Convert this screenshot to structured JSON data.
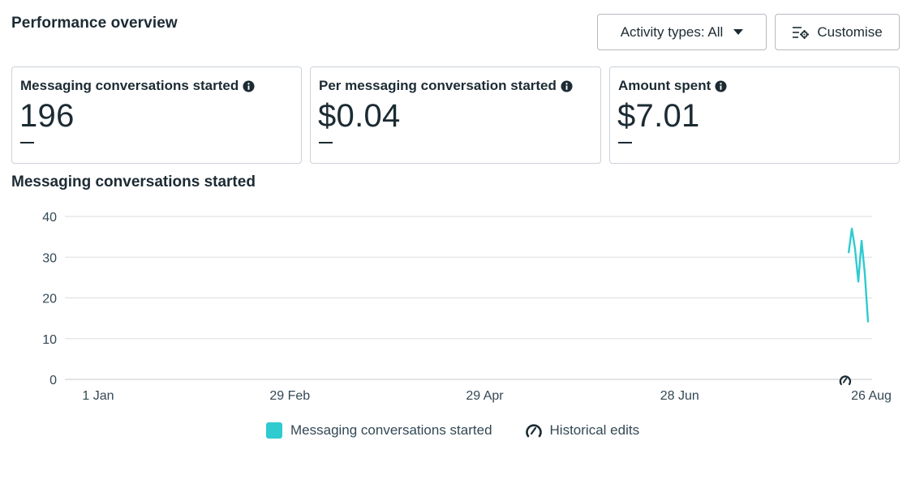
{
  "header": {
    "title": "Performance overview",
    "activity_button_label": "Activity types: All",
    "customise_button_label": "Customise"
  },
  "cards": [
    {
      "label": "Messaging conversations started",
      "value": "196",
      "delta": "—"
    },
    {
      "label": "Per messaging conversation started",
      "value": "$0.04",
      "delta": "—"
    },
    {
      "label": "Amount spent",
      "value": "$7.01",
      "delta": "—"
    }
  ],
  "chart": {
    "title": "Messaging conversations started"
  },
  "legend": {
    "series_label": "Messaging conversations started",
    "edits_label": "Historical edits"
  },
  "icons": {
    "info": "info-icon",
    "caret": "caret-down-icon",
    "customise": "customise-icon",
    "historical_edits": "historical-edits-icon"
  },
  "colors": {
    "series": "#2ecbd0",
    "text": "#1c2b33",
    "grid": "#dadde1"
  },
  "chart_data": {
    "type": "line",
    "title": "Messaging conversations started",
    "xlabel": "",
    "ylabel": "",
    "ylim": [
      0,
      40
    ],
    "yticks": [
      0,
      10,
      20,
      30,
      40
    ],
    "x_tick_labels": [
      "1 Jan",
      "29 Feb",
      "29 Apr",
      "28 Jun",
      "26 Aug"
    ],
    "x_tick_dates": [
      "2024-01-01",
      "2024-02-29",
      "2024-04-29",
      "2024-06-28",
      "2024-08-26"
    ],
    "xlim": [
      "2024-01-01",
      "2024-08-26"
    ],
    "grid": true,
    "legend_position": "bottom",
    "series": [
      {
        "name": "Messaging conversations started",
        "color": "#2ecbd0",
        "x": [
          "2024-08-19",
          "2024-08-20",
          "2024-08-21",
          "2024-08-22",
          "2024-08-23",
          "2024-08-24",
          "2024-08-25"
        ],
        "y": [
          31,
          37,
          32,
          24,
          34,
          26,
          14
        ]
      }
    ],
    "markers": [
      {
        "label": "Historical edits",
        "x": "2024-08-18"
      }
    ]
  }
}
